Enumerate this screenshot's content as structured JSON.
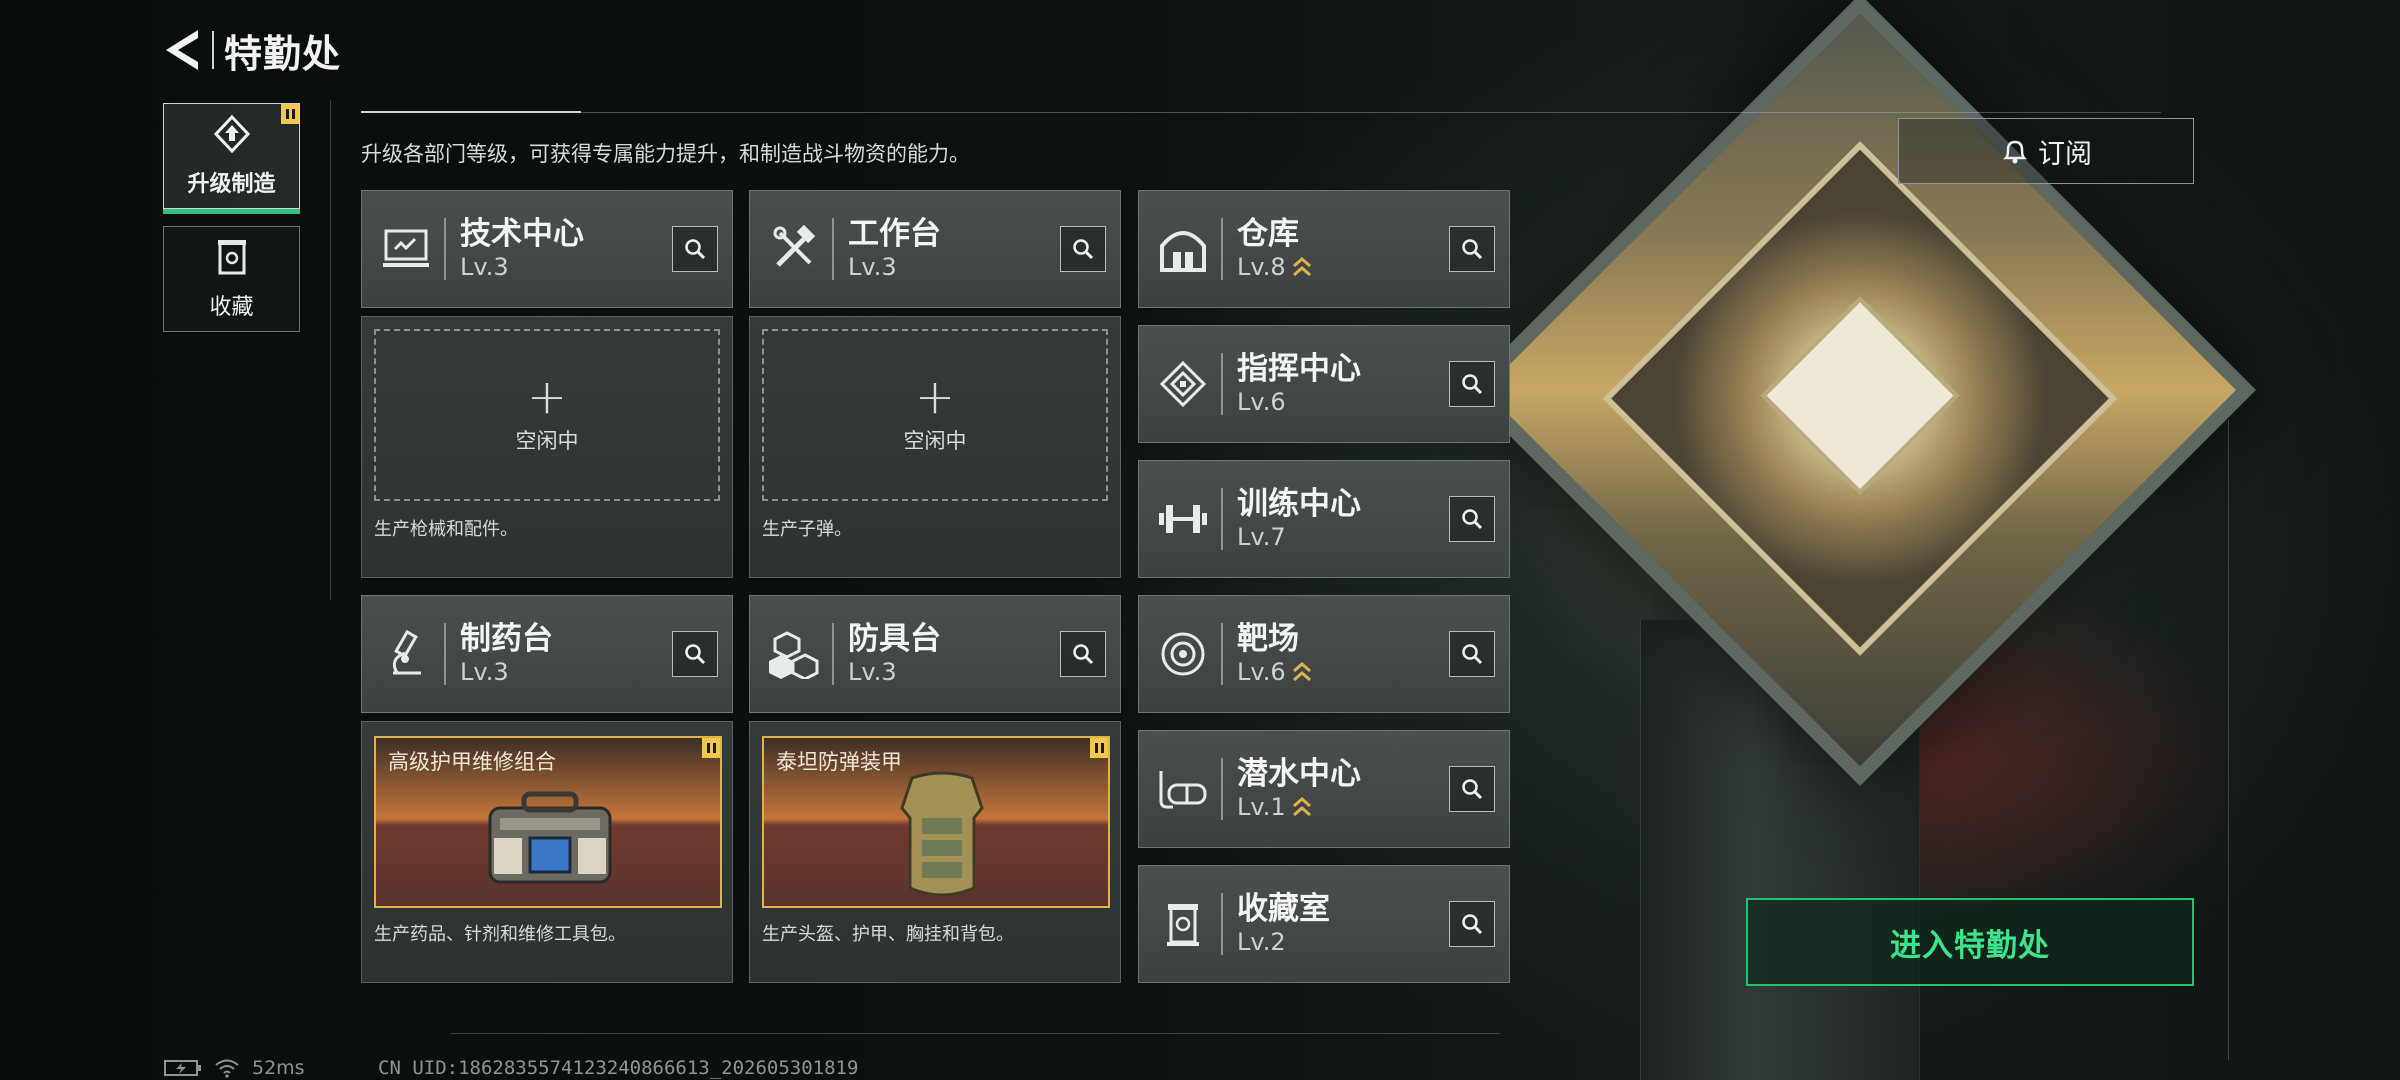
{
  "header": {
    "title": "特勤处"
  },
  "tabs": [
    {
      "label": "升级制造",
      "active": true,
      "badge": true,
      "icon": "upgrade-icon"
    },
    {
      "label": "收藏",
      "active": false,
      "badge": false,
      "icon": "collection-icon"
    }
  ],
  "description": "升级各部门等级，可获得专属能力提升，和制造战斗物资的能力。",
  "facilities": {
    "tech_center": {
      "name": "技术中心",
      "level": "Lv.3",
      "icon": "monitor-icon"
    },
    "workbench": {
      "name": "工作台",
      "level": "Lv.3",
      "icon": "tools-icon"
    },
    "pharmacy": {
      "name": "制药台",
      "level": "Lv.3",
      "icon": "microscope-icon"
    },
    "armor_bench": {
      "name": "防具台",
      "level": "Lv.3",
      "icon": "cubes-icon"
    },
    "warehouse": {
      "name": "仓库",
      "level": "Lv.8",
      "upgradable": true,
      "icon": "warehouse-icon"
    },
    "command_center": {
      "name": "指挥中心",
      "level": "Lv.6",
      "upgradable": false,
      "icon": "chip-icon"
    },
    "training_center": {
      "name": "训练中心",
      "level": "Lv.7",
      "upgradable": false,
      "icon": "dumbbell-icon"
    },
    "shooting_range": {
      "name": "靶场",
      "level": "Lv.6",
      "upgradable": true,
      "icon": "target-icon"
    },
    "diving_center": {
      "name": "潜水中心",
      "level": "Lv.1",
      "upgradable": true,
      "icon": "diving-mask-icon"
    },
    "collection_room": {
      "name": "收藏室",
      "level": "Lv.2",
      "upgradable": false,
      "icon": "trophy-icon"
    }
  },
  "production": {
    "tech_center": {
      "slot_text": "空闲中",
      "desc": "生产枪械和配件。"
    },
    "workbench": {
      "slot_text": "空闲中",
      "desc": "生产子弹。"
    },
    "pharmacy": {
      "item_name": "高级护甲维修组合",
      "desc": "生产药品、针剂和维修工具包。"
    },
    "armor_bench": {
      "item_name": "泰坦防弹装甲",
      "desc": "生产头盔、护甲、胸挂和背包。"
    }
  },
  "buttons": {
    "subscribe": "订阅",
    "enter": "进入特勤处"
  },
  "status": {
    "ping": "52ms",
    "uid": "CN UID:1862835574123240866613_202605301819"
  },
  "colors": {
    "accent_green": "#2ec27e",
    "badge_yellow": "#f2c94c",
    "item_border": "#e0b34a"
  }
}
